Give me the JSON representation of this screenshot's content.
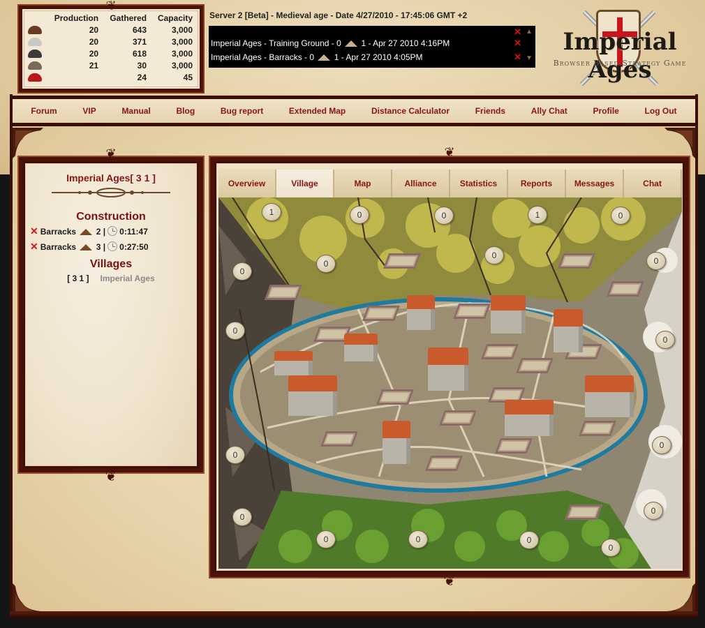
{
  "resources": {
    "headers": [
      "Production",
      "Gathered",
      "Capacity"
    ],
    "rows": [
      {
        "icon": "wood-icon",
        "color": "#6b3a22",
        "production": "20",
        "gathered": "643",
        "capacity": "3,000"
      },
      {
        "icon": "silver-icon",
        "color": "#c8c8c8",
        "production": "20",
        "gathered": "371",
        "capacity": "3,000"
      },
      {
        "icon": "stone-icon",
        "color": "#3a3a3a",
        "production": "20",
        "gathered": "618",
        "capacity": "3,000"
      },
      {
        "icon": "iron-icon",
        "color": "#7a6a5a",
        "production": "21",
        "gathered": "30",
        "capacity": "3,000"
      },
      {
        "icon": "food-icon",
        "color": "#b81818",
        "production": "",
        "gathered": "24",
        "capacity": "45"
      }
    ]
  },
  "header": {
    "server_line": "Server 2 [Beta] - Medieval age - Date 4/27/2010 - 17:45:06 GMT +2"
  },
  "notifications": [
    {
      "before": "Imperial Ages - Training Ground - 0",
      "after": "1 - Apr 27 2010 4:16PM"
    },
    {
      "before": "Imperial Ages - Barracks - 0",
      "after": "1 - Apr 27 2010 4:05PM"
    }
  ],
  "logo": {
    "title": "Imperial Ages",
    "subtitle": "Browser Based Strategy Game"
  },
  "nav": [
    "Forum",
    "VIP",
    "Manual",
    "Blog",
    "Bug report",
    "Extended Map",
    "Distance Calculator",
    "Friends",
    "Ally Chat",
    "Profile",
    "Log Out"
  ],
  "left_panel": {
    "village_title": "Imperial Ages[ 3 1 ]",
    "construction_title": "Construction",
    "construction": [
      {
        "building": "Barracks",
        "level": "2 |",
        "time": "0:11:47"
      },
      {
        "building": "Barracks",
        "level": "3 |",
        "time": "0:27:50"
      }
    ],
    "villages_title": "Villages",
    "villages": [
      {
        "coords": "[ 3 1 ]",
        "name": "Imperial Ages"
      }
    ]
  },
  "tabs": [
    {
      "label": "Overview",
      "active": false
    },
    {
      "label": "Village",
      "active": true
    },
    {
      "label": "Map",
      "active": false
    },
    {
      "label": "Alliance",
      "active": false
    },
    {
      "label": "Statistics",
      "active": false
    },
    {
      "label": "Reports",
      "active": false
    },
    {
      "label": "Messages",
      "active": false
    },
    {
      "label": "Chat",
      "active": false
    }
  ],
  "map": {
    "field_levels": [
      "1",
      "0",
      "0",
      "1",
      "0",
      "0",
      "0",
      "0",
      "0",
      "0",
      "0",
      "0",
      "0",
      "0",
      "0",
      "0",
      "0",
      "0",
      "0"
    ]
  }
}
